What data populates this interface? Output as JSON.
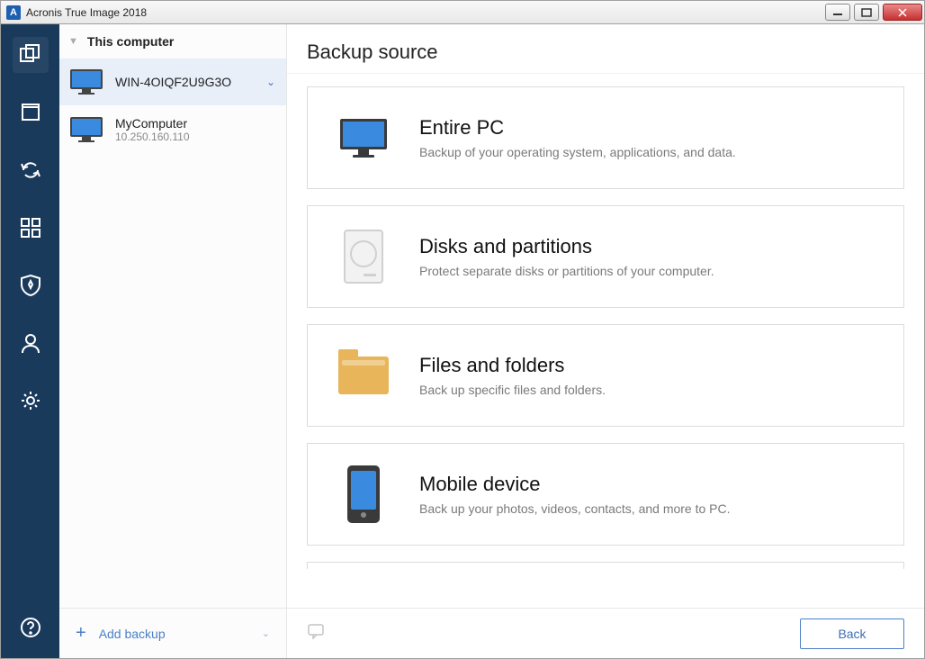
{
  "window": {
    "title": "Acronis True Image 2018",
    "app_letter": "A"
  },
  "sidebar": {
    "header": "This computer",
    "devices": [
      {
        "name": "WIN-4OIQF2U9G3O",
        "sub": "",
        "selected": true
      },
      {
        "name": "MyComputer",
        "sub": "10.250.160.110",
        "selected": false
      }
    ],
    "add_backup": "Add backup"
  },
  "main": {
    "title": "Backup source",
    "options": [
      {
        "title": "Entire PC",
        "desc": "Backup of your operating system, applications, and data.",
        "icon": "pc"
      },
      {
        "title": "Disks and partitions",
        "desc": "Protect separate disks or partitions of your computer.",
        "icon": "disk"
      },
      {
        "title": "Files and folders",
        "desc": "Back up specific files and folders.",
        "icon": "folder"
      },
      {
        "title": "Mobile device",
        "desc": "Back up your photos, videos, contacts, and more to PC.",
        "icon": "mobile"
      }
    ],
    "back_button": "Back"
  }
}
